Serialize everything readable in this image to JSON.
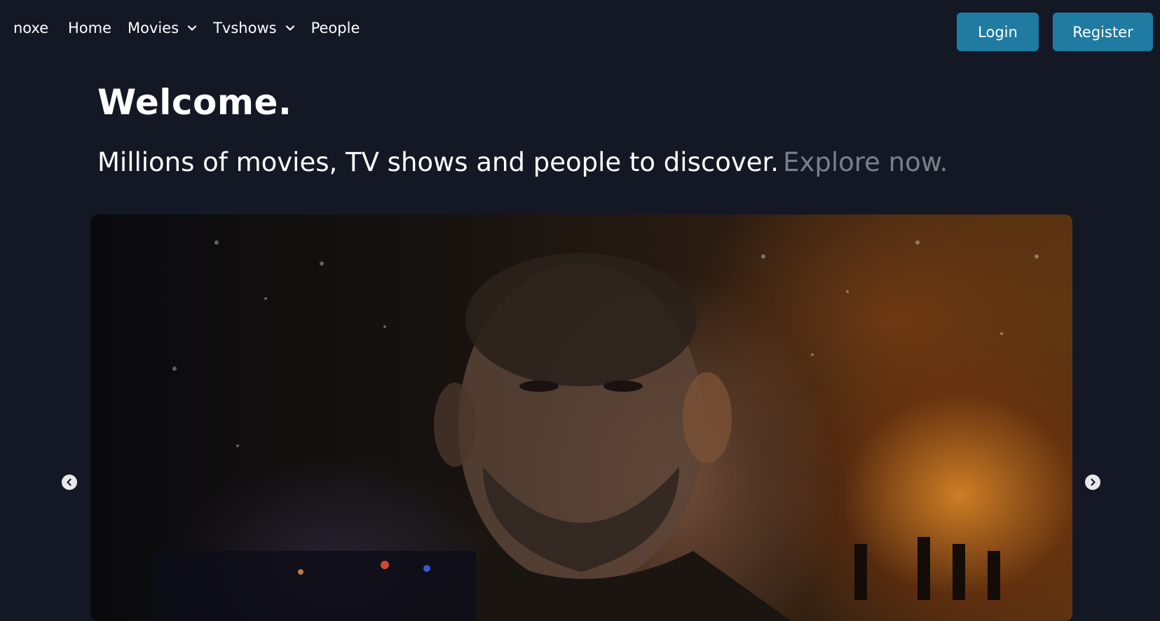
{
  "navbar": {
    "brand": "noxe",
    "links": [
      {
        "label": "Home",
        "has_dropdown": false
      },
      {
        "label": "Movies",
        "has_dropdown": true
      },
      {
        "label": "Tvshows",
        "has_dropdown": true
      },
      {
        "label": "People",
        "has_dropdown": false
      }
    ],
    "login_label": "Login",
    "register_label": "Register"
  },
  "hero": {
    "title": "Welcome.",
    "tagline": "Millions of movies, TV shows and people to discover.",
    "explore": "Explore now."
  },
  "carousel": {
    "prev_icon": "chevron-left-circle-icon",
    "next_icon": "chevron-right-circle-icon"
  },
  "colors": {
    "background": "#141824",
    "button": "#1f7ba1",
    "muted_text": "#7b7f88"
  }
}
